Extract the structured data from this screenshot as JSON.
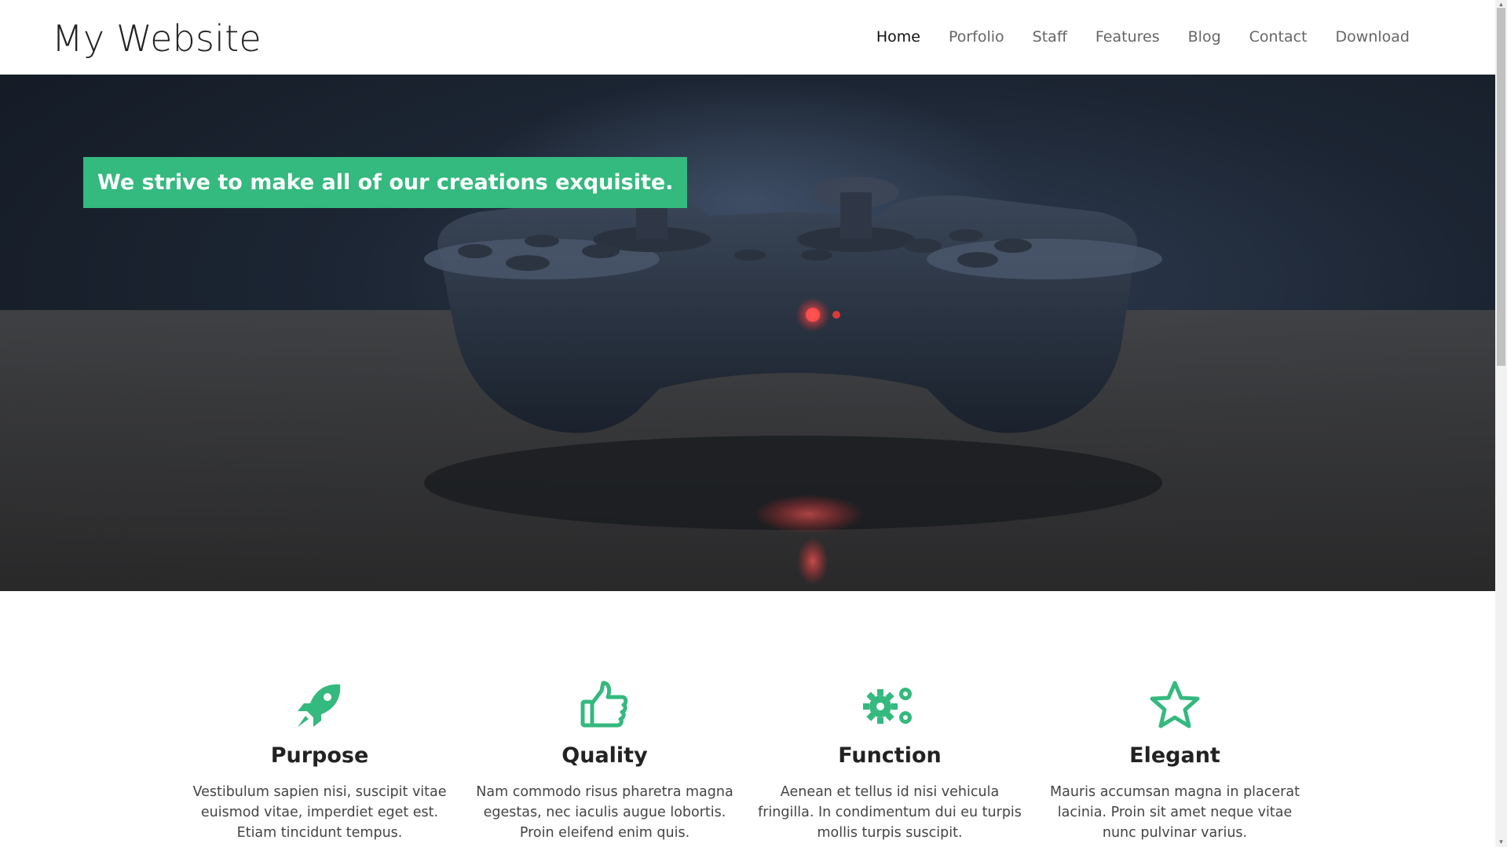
{
  "header": {
    "brand": "My Website",
    "nav": [
      {
        "label": "Home",
        "active": true
      },
      {
        "label": "Porfolio",
        "active": false
      },
      {
        "label": "Staff",
        "active": false
      },
      {
        "label": "Features",
        "active": false
      },
      {
        "label": "Blog",
        "active": false
      },
      {
        "label": "Contact",
        "active": false
      },
      {
        "label": "Download",
        "active": false
      }
    ]
  },
  "hero": {
    "tagline": "We strive to make all of our creations exquisite.",
    "image": "game-controller-photo",
    "accent": "#34b97f"
  },
  "features": [
    {
      "icon": "rocket-icon",
      "title": "Purpose",
      "text": "Vestibulum sapien nisi, suscipit vitae euismod vitae, imperdiet eget est. Etiam tincidunt tempus."
    },
    {
      "icon": "thumbs-up-icon",
      "title": "Quality",
      "text": "Nam commodo risus pharetra magna egestas, nec iaculis augue lobortis. Proin eleifend enim quis."
    },
    {
      "icon": "gears-icon",
      "title": "Function",
      "text": "Aenean et tellus id nisi vehicula fringilla. In condimentum dui eu turpis mollis turpis suscipit."
    },
    {
      "icon": "star-icon",
      "title": "Elegant",
      "text": "Mauris accumsan magna in placerat lacinia. Proin sit amet neque vitae nunc pulvinar varius."
    }
  ],
  "colors": {
    "accent": "#34b97f",
    "text": "#222222",
    "muted": "#666666"
  }
}
